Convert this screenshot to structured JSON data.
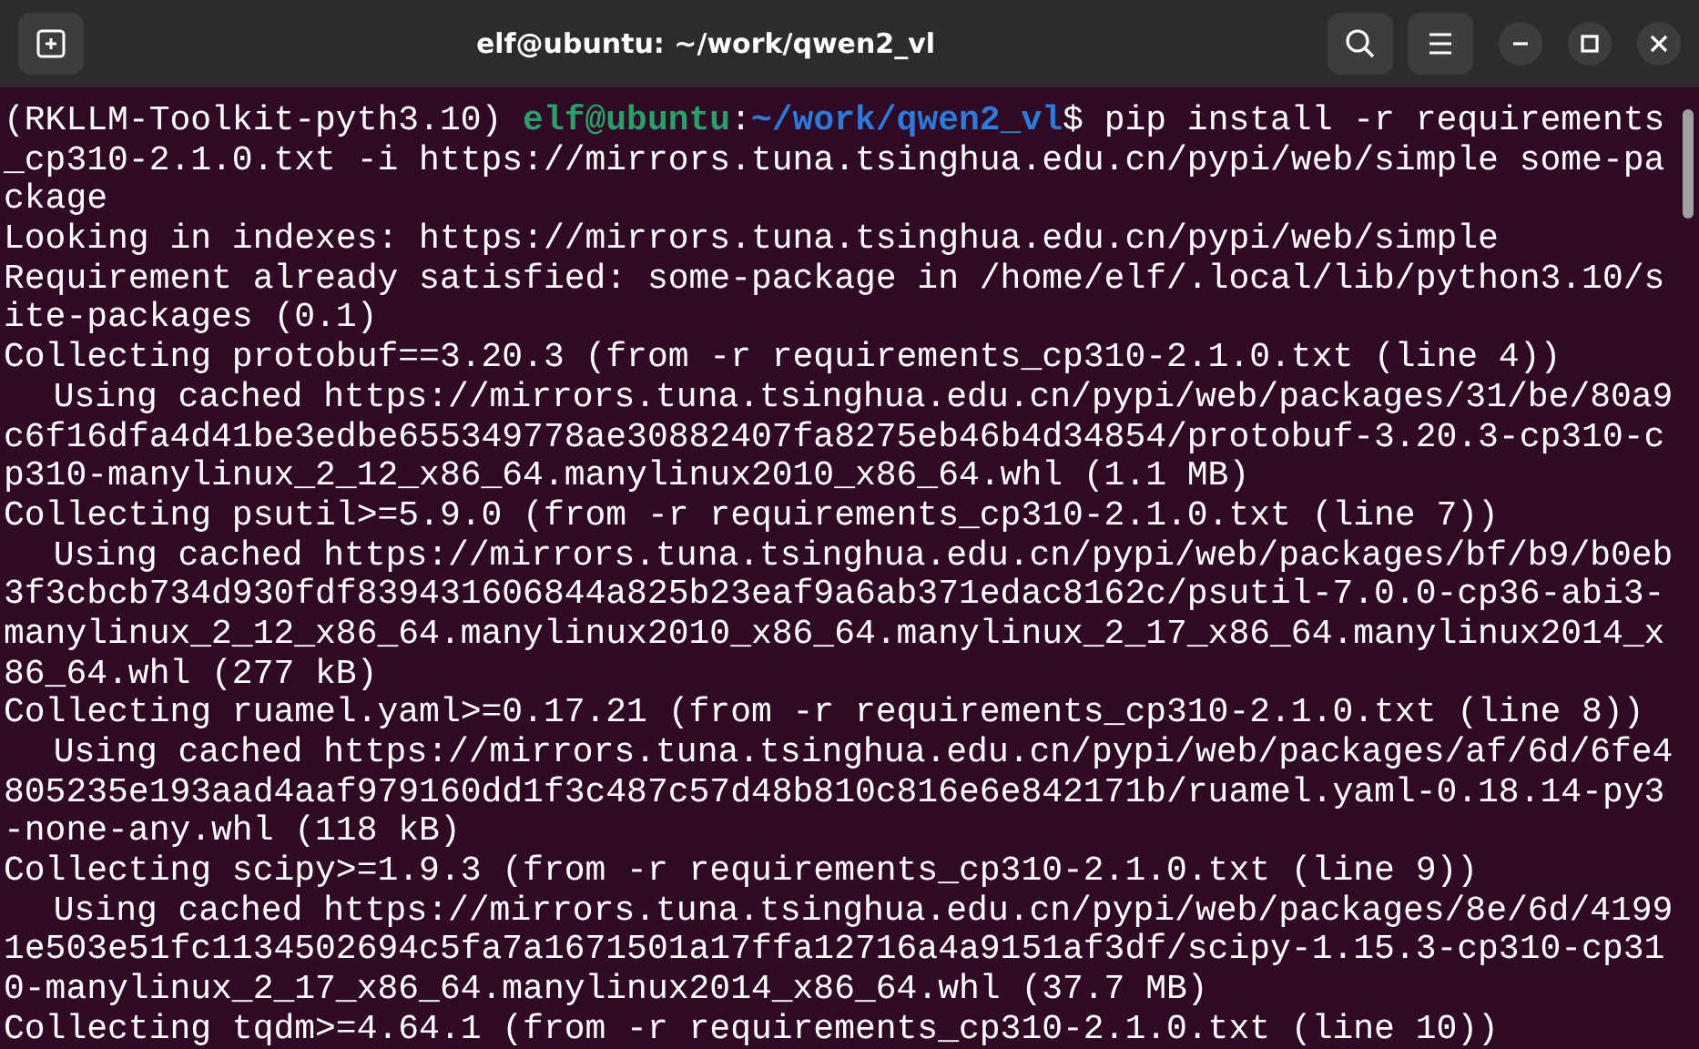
{
  "window": {
    "title": "elf@ubuntu: ~/work/qwen2_vl"
  },
  "terminal": {
    "lines": [
      {
        "kind": "prompt",
        "env": "(RKLLM-Toolkit-pyth3.10) ",
        "user_host": "elf@ubuntu",
        "separator": ":",
        "path": "~/work/qwen2_vl",
        "command": "$ pip install -r requirements"
      },
      {
        "kind": "plain",
        "text": "_cp310-2.1.0.txt -i https://mirrors.tuna.tsinghua.edu.cn/pypi/web/simple some-pa"
      },
      {
        "kind": "plain",
        "text": "ckage"
      },
      {
        "kind": "plain",
        "text": "Looking in indexes: https://mirrors.tuna.tsinghua.edu.cn/pypi/web/simple"
      },
      {
        "kind": "plain",
        "text": "Requirement already satisfied: some-package in /home/elf/.local/lib/python3.10/s"
      },
      {
        "kind": "plain",
        "text": "ite-packages (0.1)"
      },
      {
        "kind": "plain",
        "text": "Collecting protobuf==3.20.3 (from -r requirements_cp310-2.1.0.txt (line 4))"
      },
      {
        "kind": "indented",
        "text": "Using cached https://mirrors.tuna.tsinghua.edu.cn/pypi/web/packages/31/be/80a9"
      },
      {
        "kind": "plain",
        "text": "c6f16dfa4d41be3edbe655349778ae30882407fa8275eb46b4d34854/protobuf-3.20.3-cp310-c"
      },
      {
        "kind": "plain",
        "text": "p310-manylinux_2_12_x86_64.manylinux2010_x86_64.whl (1.1 MB)"
      },
      {
        "kind": "plain",
        "text": "Collecting psutil>=5.9.0 (from -r requirements_cp310-2.1.0.txt (line 7))"
      },
      {
        "kind": "indented",
        "text": "Using cached https://mirrors.tuna.tsinghua.edu.cn/pypi/web/packages/bf/b9/b0eb"
      },
      {
        "kind": "plain",
        "text": "3f3cbcb734d930fdf839431606844a825b23eaf9a6ab371edac8162c/psutil-7.0.0-cp36-abi3-"
      },
      {
        "kind": "plain",
        "text": "manylinux_2_12_x86_64.manylinux2010_x86_64.manylinux_2_17_x86_64.manylinux2014_x"
      },
      {
        "kind": "plain",
        "text": "86_64.whl (277 kB)"
      },
      {
        "kind": "plain",
        "text": "Collecting ruamel.yaml>=0.17.21 (from -r requirements_cp310-2.1.0.txt (line 8))"
      },
      {
        "kind": "indented",
        "text": "Using cached https://mirrors.tuna.tsinghua.edu.cn/pypi/web/packages/af/6d/6fe4"
      },
      {
        "kind": "plain",
        "text": "805235e193aad4aaf979160dd1f3c487c57d48b810c816e6e842171b/ruamel.yaml-0.18.14-py3"
      },
      {
        "kind": "plain",
        "text": "-none-any.whl (118 kB)"
      },
      {
        "kind": "plain",
        "text": "Collecting scipy>=1.9.3 (from -r requirements_cp310-2.1.0.txt (line 9))"
      },
      {
        "kind": "indented",
        "text": "Using cached https://mirrors.tuna.tsinghua.edu.cn/pypi/web/packages/8e/6d/4199"
      },
      {
        "kind": "plain",
        "text": "1e503e51fc1134502694c5fa7a1671501a17ffa12716a4a9151af3df/scipy-1.15.3-cp310-cp31"
      },
      {
        "kind": "plain",
        "text": "0-manylinux_2_17_x86_64.manylinux2014_x86_64.whl (37.7 MB)"
      },
      {
        "kind": "plain",
        "text": "Collecting tqdm>=4.64.1 (from -r requirements_cp310-2.1.0.txt (line 10))"
      }
    ]
  }
}
